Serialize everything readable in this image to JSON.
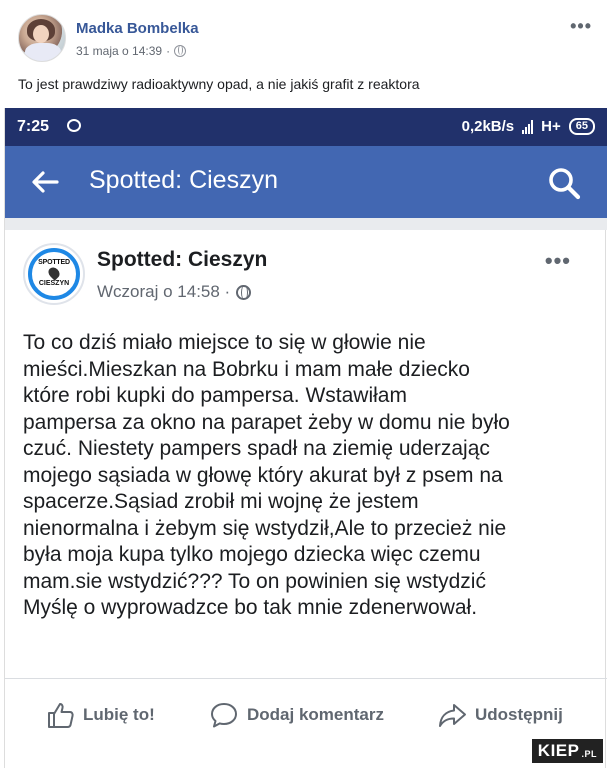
{
  "outer_post": {
    "author": "Madka Bombelka",
    "date": "31 maja o 14:39",
    "caption": "To jest prawdziwy radioaktywny opad, a nie jakiś grafit z reaktora",
    "more_icon": "ellipsis-icon",
    "more_label": "•••"
  },
  "phone": {
    "status": {
      "time": "7:25",
      "speed": "0,2kB/s",
      "network": "H+",
      "battery": "65"
    },
    "appbar": {
      "title": "Spotted: Cieszyn",
      "back_icon": "arrow-left-icon",
      "search_icon": "search-icon"
    },
    "post": {
      "page_name": "Spotted: Cieszyn",
      "avatar_top": "SPOTTED",
      "avatar_bottom": "CIESZYN",
      "time": "Wczoraj o 14:58 ·",
      "more_label": "•••",
      "lines": [
        "To co dziś miało miejsce to się w głowie nie",
        "mieści.Mieszkan na Bobrku i mam małe dziecko",
        "które robi kupki do pampersa. Wstawiłam",
        "pampersa za okno na parapet żeby w domu nie było",
        "czuć. Niestety pampers spadł na ziemię uderzając",
        "mojego sąsiada w głowę który akurat był z psem na",
        "spacerze.Sąsiad zrobił mi wojnę że jestem",
        "nienormalna i żebym się wstydził,Ale to przecież nie",
        "była moja kupa tylko mojego dziecka więc czemu",
        "mam.sie wstydzić??? To on powinien się wstydzić",
        "Myślę o wyprowadzce bo tak mnie zdenerwował."
      ],
      "actions": {
        "like": "Lubię to!",
        "comment": "Dodaj komentarz",
        "share": "Udostępnij"
      }
    }
  },
  "watermark": {
    "text": "KIEP",
    "suffix": ".PL"
  },
  "colors": {
    "facebook_blue": "#4267b2",
    "statusbar": "#21316b",
    "link": "#385898"
  }
}
